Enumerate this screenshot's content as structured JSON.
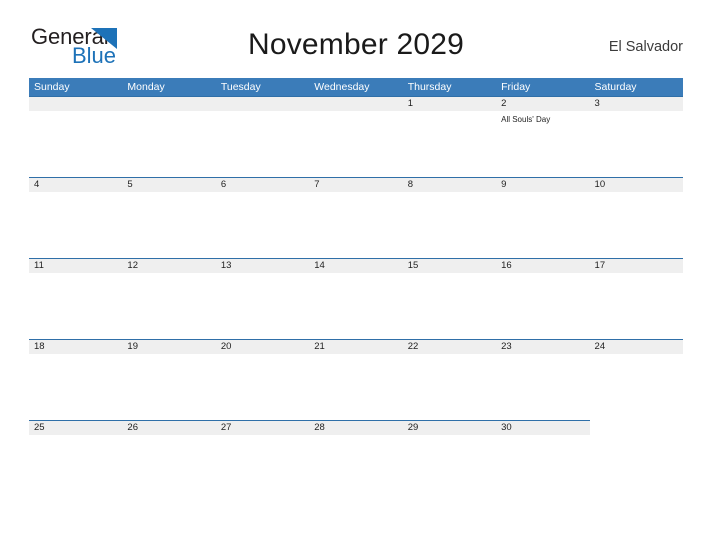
{
  "brand": {
    "name_part1": "General",
    "name_part2": "Blue",
    "triangle_color": "#1d72b8"
  },
  "header": {
    "title": "November 2029",
    "subtitle": "El Salvador"
  },
  "theme": {
    "header_blue": "#3b7cb9",
    "band_gray": "#efefef",
    "band_rule": "#2f6fa8",
    "text_dark": "#1f1f1f"
  },
  "calendar": {
    "weekdays": [
      "Sunday",
      "Monday",
      "Tuesday",
      "Wednesday",
      "Thursday",
      "Friday",
      "Saturday"
    ],
    "weeks": [
      {
        "band_columns": 7,
        "days": [
          {
            "num": "",
            "events": []
          },
          {
            "num": "",
            "events": []
          },
          {
            "num": "",
            "events": []
          },
          {
            "num": "",
            "events": []
          },
          {
            "num": "1",
            "events": []
          },
          {
            "num": "2",
            "events": [
              "All Souls' Day"
            ]
          },
          {
            "num": "3",
            "events": []
          }
        ]
      },
      {
        "band_columns": 7,
        "days": [
          {
            "num": "4",
            "events": []
          },
          {
            "num": "5",
            "events": []
          },
          {
            "num": "6",
            "events": []
          },
          {
            "num": "7",
            "events": []
          },
          {
            "num": "8",
            "events": []
          },
          {
            "num": "9",
            "events": []
          },
          {
            "num": "10",
            "events": []
          }
        ]
      },
      {
        "band_columns": 7,
        "days": [
          {
            "num": "11",
            "events": []
          },
          {
            "num": "12",
            "events": []
          },
          {
            "num": "13",
            "events": []
          },
          {
            "num": "14",
            "events": []
          },
          {
            "num": "15",
            "events": []
          },
          {
            "num": "16",
            "events": []
          },
          {
            "num": "17",
            "events": []
          }
        ]
      },
      {
        "band_columns": 7,
        "days": [
          {
            "num": "18",
            "events": []
          },
          {
            "num": "19",
            "events": []
          },
          {
            "num": "20",
            "events": []
          },
          {
            "num": "21",
            "events": []
          },
          {
            "num": "22",
            "events": []
          },
          {
            "num": "23",
            "events": []
          },
          {
            "num": "24",
            "events": []
          }
        ]
      },
      {
        "band_columns": 6,
        "days": [
          {
            "num": "25",
            "events": []
          },
          {
            "num": "26",
            "events": []
          },
          {
            "num": "27",
            "events": []
          },
          {
            "num": "28",
            "events": []
          },
          {
            "num": "29",
            "events": []
          },
          {
            "num": "30",
            "events": []
          },
          {
            "num": "",
            "events": []
          }
        ]
      }
    ]
  }
}
